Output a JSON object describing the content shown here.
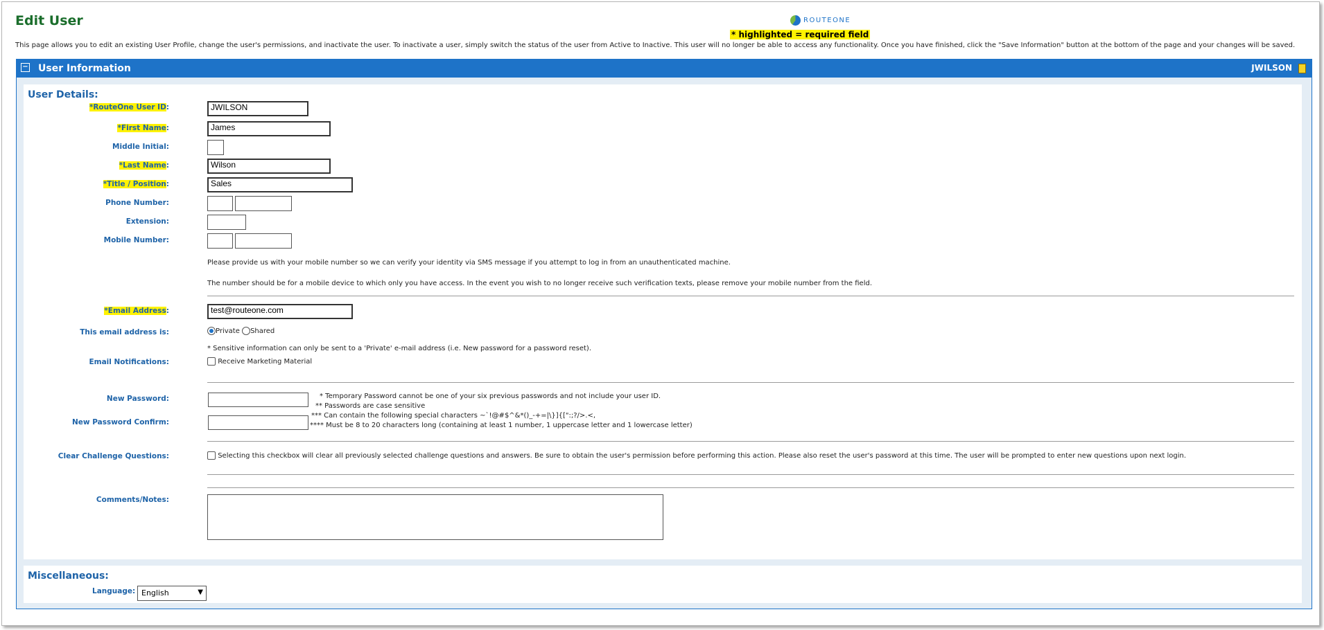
{
  "page": {
    "title": "Edit User",
    "logo_text": "ROUTEONE",
    "required_legend": "* highlighted = required field",
    "intro": "This page allows you to edit an existing User Profile, change the user's permissions, and inactivate the user. To inactivate a user, simply switch the status of the user from Active to Inactive. This user will no longer be able to access any functionality. Once you have finished, click the \"Save Information\" button at the bottom of the page and your changes will be saved."
  },
  "panel": {
    "collapse": "−",
    "title": "User Information",
    "user": "JWILSON",
    "icon": "document-icon"
  },
  "details": {
    "title": "User Details:",
    "userid_label": "*RouteOne User ID",
    "userid_value": "JWILSON",
    "firstname_label": "*First Name",
    "firstname_value": "James",
    "middle_label": "Middle Initial:",
    "middle_value": "",
    "lastname_label": "*Last Name",
    "lastname_value": "Wilson",
    "title_label": "*Title / Position",
    "title_value": "Sales",
    "phone_label": "Phone Number:",
    "extension_label": "Extension:",
    "mobile_label": "Mobile Number:",
    "mobile_note_1": "Please provide us with your mobile number so we can verify your identity via SMS message if you attempt to log in from an unauthenticated machine.",
    "mobile_note_2": "The number should be for a mobile device to which only you have access. In the event you wish to no longer receive such verification texts, please remove your mobile number from the field.",
    "email_label": "*Email Address",
    "email_value": "test@routeone.com",
    "email_type_label": "This email address is:",
    "email_private": "Private",
    "email_shared": "Shared",
    "email_note": "* Sensitive information can only be sent to a 'Private' e-mail address (i.e. New password for a password reset).",
    "notif_label": "Email Notifications:",
    "notif_option": "Receive Marketing Material",
    "newpw_label": "New Password:",
    "newpw_confirm_label": "New Password Confirm:",
    "pw_rule_1": "* Temporary Password cannot be one of your six previous passwords and not include your user ID.",
    "pw_rule_2": "** Passwords are case sensitive",
    "pw_rule_3": "*** Can contain the following special characters ~`!@#$^&*()_-+=|\\}]{[\":;?/>.<,",
    "pw_rule_4": "**** Must be 8 to 20 characters long (containing at least 1 number, 1 uppercase letter and 1 lowercase letter)",
    "clear_label": "Clear Challenge Questions:",
    "clear_note": "Selecting this checkbox will clear all previously selected challenge questions and answers. Be sure to obtain the user's permission before performing this action. Please also reset the user's password at this time. The user will be prompted to enter new questions upon next login.",
    "comments_label": "Comments/Notes:"
  },
  "misc": {
    "title": "Miscellaneous:",
    "language_label": "Language:",
    "language_value": "English"
  },
  "colors": {
    "accent": "#1e73c8",
    "required_highlight": "#fff200",
    "title_green": "#1b6e2c"
  }
}
